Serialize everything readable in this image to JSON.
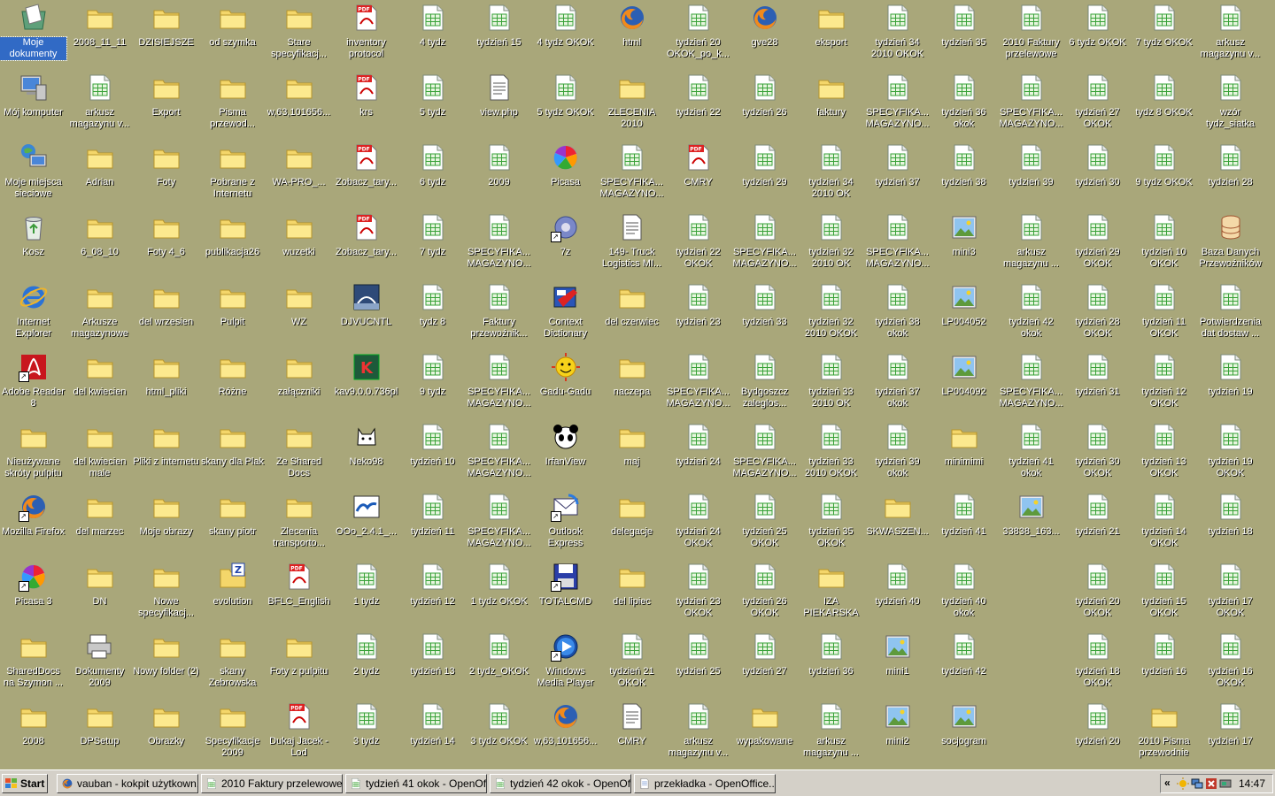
{
  "colors": {
    "desktop": "#A9A77A",
    "taskbar": "#D4D0C8",
    "selection": "#316AC5"
  },
  "columns": [
    [
      {
        "label": "Moje dokumenty",
        "icon": "my-documents-icon",
        "selected": true
      },
      {
        "label": "Mój komputer",
        "icon": "my-computer-icon"
      },
      {
        "label": "Moje miejsca sieciowe",
        "icon": "network-places-icon"
      },
      {
        "label": "Kosz",
        "icon": "recycle-bin-icon"
      },
      {
        "label": "Internet Explorer",
        "icon": "internet-explorer-icon"
      },
      {
        "label": "Adobe Reader 8",
        "icon": "adobe-reader-icon",
        "shortcut": true
      },
      {
        "label": "Nieużywane skróty pulpitu",
        "icon": "folder-icon"
      },
      {
        "label": "Mozilla Firefox",
        "icon": "firefox-icon",
        "shortcut": true
      },
      {
        "label": "Picasa 3",
        "icon": "picasa-icon",
        "shortcut": true
      },
      {
        "label": "SharedDocs na Szymon ...",
        "icon": "folder-icon"
      },
      {
        "label": "2008",
        "icon": "folder-icon"
      }
    ],
    [
      {
        "label": "2008_11_11",
        "icon": "folder-icon"
      },
      {
        "label": "arkusz magazynu v...",
        "icon": "spreadsheet-icon"
      },
      {
        "label": "Adrian",
        "icon": "folder-icon"
      },
      {
        "label": "6_08_10",
        "icon": "folder-icon"
      },
      {
        "label": "Arkusze magazynowe",
        "icon": "folder-icon"
      },
      {
        "label": "del kwiecien",
        "icon": "folder-icon"
      },
      {
        "label": "del kwiecien male",
        "icon": "folder-icon"
      },
      {
        "label": "del marzec",
        "icon": "folder-icon"
      },
      {
        "label": "DN",
        "icon": "folder-icon"
      },
      {
        "label": "Dokumenty 2009",
        "icon": "printer-folder-icon"
      },
      {
        "label": "DPSetup",
        "icon": "folder-icon"
      }
    ],
    [
      {
        "label": "DZISIEJSZE",
        "icon": "folder-icon"
      },
      {
        "label": "Export",
        "icon": "folder-icon"
      },
      {
        "label": "Foty",
        "icon": "folder-icon"
      },
      {
        "label": "Foty 4_6",
        "icon": "folder-icon"
      },
      {
        "label": "del wrzesien",
        "icon": "folder-icon"
      },
      {
        "label": "html_pliki",
        "icon": "folder-icon"
      },
      {
        "label": "Pliki z internetu",
        "icon": "folder-icon"
      },
      {
        "label": "Moje obrazy",
        "icon": "folder-icon"
      },
      {
        "label": "Nowe specyfikacj...",
        "icon": "folder-icon"
      },
      {
        "label": "Nowy folder (2)",
        "icon": "folder-icon"
      },
      {
        "label": "Obrazky",
        "icon": "folder-icon"
      }
    ],
    [
      {
        "label": "od szymka",
        "icon": "folder-icon"
      },
      {
        "label": "Pisma przewod...",
        "icon": "folder-icon"
      },
      {
        "label": "Pobrane z Internetu",
        "icon": "folder-icon"
      },
      {
        "label": "publikacja26",
        "icon": "folder-icon"
      },
      {
        "label": "Pulpit",
        "icon": "folder-icon"
      },
      {
        "label": "Różne",
        "icon": "folder-icon"
      },
      {
        "label": "skany dla Plak",
        "icon": "folder-icon"
      },
      {
        "label": "skany piotr",
        "icon": "folder-icon"
      },
      {
        "label": "evolution",
        "icon": "zip-folder-icon"
      },
      {
        "label": "skany Zebrowska",
        "icon": "folder-icon"
      },
      {
        "label": "Specyfikacje 2009",
        "icon": "folder-icon"
      }
    ],
    [
      {
        "label": "Stare specyfikacj...",
        "icon": "folder-icon"
      },
      {
        "label": "w,63,101656...",
        "icon": "folder-icon"
      },
      {
        "label": "WA-PRO_...",
        "icon": "folder-icon"
      },
      {
        "label": "wuzetki",
        "icon": "folder-icon"
      },
      {
        "label": "WZ",
        "icon": "folder-icon"
      },
      {
        "label": "załączniki",
        "icon": "folder-icon"
      },
      {
        "label": "Ze Shared Docs",
        "icon": "folder-icon"
      },
      {
        "label": "Zlecenia transporto...",
        "icon": "open-folder-icon"
      },
      {
        "label": "BFLC_English",
        "icon": "pdf-icon"
      },
      {
        "label": "Foty z pulpitu",
        "icon": "folder-icon"
      },
      {
        "label": "Dukaj Jacek - Lod",
        "icon": "pdf-icon"
      }
    ],
    [
      {
        "label": "inventory protocol",
        "icon": "pdf-icon"
      },
      {
        "label": "krs",
        "icon": "pdf-icon"
      },
      {
        "label": "Zobacz_tary...",
        "icon": "pdf-icon"
      },
      {
        "label": "Zobacz_tary...",
        "icon": "pdf-icon"
      },
      {
        "label": "DJVUCNTL",
        "icon": "djvu-icon"
      },
      {
        "label": "kav9.0.0.736pl",
        "icon": "kaspersky-icon"
      },
      {
        "label": "Neko98",
        "icon": "cat-icon"
      },
      {
        "label": "OOo_2.4.1_...",
        "icon": "openoffice-icon"
      },
      {
        "label": "1 tydz",
        "icon": "spreadsheet-icon"
      },
      {
        "label": "2 tydz",
        "icon": "spreadsheet-icon"
      },
      {
        "label": "3 tydz",
        "icon": "spreadsheet-icon"
      }
    ],
    [
      {
        "label": "4 tydz",
        "icon": "spreadsheet-icon"
      },
      {
        "label": "5 tydz",
        "icon": "spreadsheet-icon"
      },
      {
        "label": "6 tydz",
        "icon": "spreadsheet-icon"
      },
      {
        "label": "7 tydz",
        "icon": "spreadsheet-icon"
      },
      {
        "label": "tydz 8",
        "icon": "spreadsheet-icon"
      },
      {
        "label": "9 tydz",
        "icon": "spreadsheet-icon"
      },
      {
        "label": "tydzień 10",
        "icon": "spreadsheet-icon"
      },
      {
        "label": "tydzień 11",
        "icon": "spreadsheet-icon"
      },
      {
        "label": "tydzień 12",
        "icon": "spreadsheet-icon"
      },
      {
        "label": "tydzień 13",
        "icon": "spreadsheet-icon"
      },
      {
        "label": "tydzień 14",
        "icon": "spreadsheet-icon"
      }
    ],
    [
      {
        "label": "tydzień 15",
        "icon": "spreadsheet-icon"
      },
      {
        "label": "view.php",
        "icon": "php-file-icon"
      },
      {
        "label": "2009",
        "icon": "spreadsheet-icon"
      },
      {
        "label": "SPECYFIKA... MAGAZYNO...",
        "icon": "spreadsheet-icon"
      },
      {
        "label": "Faktury przewoźnik...",
        "icon": "spreadsheet-icon"
      },
      {
        "label": "SPECYFIKA... MAGAZYNO...",
        "icon": "spreadsheet-icon"
      },
      {
        "label": "SPECYFIKA... MAGAZYNO...",
        "icon": "spreadsheet-icon"
      },
      {
        "label": "SPECYFIKA... MAGAZYNO...",
        "icon": "spreadsheet-icon"
      },
      {
        "label": "1 tydz OKOK",
        "icon": "spreadsheet-icon"
      },
      {
        "label": "2 tydz_OKOK",
        "icon": "spreadsheet-icon"
      },
      {
        "label": "3 tydz OKOK",
        "icon": "spreadsheet-icon"
      }
    ],
    [
      {
        "label": "4 tydz OKOK",
        "icon": "spreadsheet-icon"
      },
      {
        "label": "5 tydz OKOK",
        "icon": "spreadsheet-icon"
      },
      {
        "label": "Picasa",
        "icon": "picasa-file-icon"
      },
      {
        "label": "7z",
        "icon": "7z-icon",
        "shortcut": true
      },
      {
        "label": "Context Dictionary",
        "icon": "dictionary-icon"
      },
      {
        "label": "Gadu-Gadu",
        "icon": "gadu-gadu-icon"
      },
      {
        "label": "IrfanView",
        "icon": "irfanview-icon"
      },
      {
        "label": "Outlook Express",
        "icon": "outlook-express-icon",
        "shortcut": true
      },
      {
        "label": "TOTALCMD",
        "icon": "totalcmd-icon",
        "shortcut": true
      },
      {
        "label": "Windows Media Player",
        "icon": "media-player-icon",
        "shortcut": true
      },
      {
        "label": "w,63,101656...",
        "icon": "firefox-html-icon"
      }
    ],
    [
      {
        "label": "html",
        "icon": "firefox-html-icon"
      },
      {
        "label": "ZLECENIA 2010",
        "icon": "folder-icon"
      },
      {
        "label": "SPECYFIKA... MAGAZYNO...",
        "icon": "spreadsheet-icon"
      },
      {
        "label": "149- Truck Logistics MI...",
        "icon": "text-file-icon"
      },
      {
        "label": "del czerwiec",
        "icon": "folder-icon"
      },
      {
        "label": "naczepa",
        "icon": "folder-icon"
      },
      {
        "label": "maj",
        "icon": "folder-icon"
      },
      {
        "label": "delegacje",
        "icon": "folder-icon"
      },
      {
        "label": "del lipiec",
        "icon": "folder-icon"
      },
      {
        "label": "tydzień 21 OKOK",
        "icon": "spreadsheet-icon"
      },
      {
        "label": "CMRY",
        "icon": "text-file-icon"
      }
    ],
    [
      {
        "label": "tydzień 20 OKOK_po_k...",
        "icon": "spreadsheet-icon"
      },
      {
        "label": "tydzień 22",
        "icon": "spreadsheet-icon"
      },
      {
        "label": "CMRY",
        "icon": "pdf-icon"
      },
      {
        "label": "tydzień 22 OKOK",
        "icon": "spreadsheet-icon"
      },
      {
        "label": "tydzień 23",
        "icon": "spreadsheet-icon"
      },
      {
        "label": "SPECYFIKA... MAGAZYNO...",
        "icon": "spreadsheet-icon"
      },
      {
        "label": "tydzień 24",
        "icon": "spreadsheet-icon"
      },
      {
        "label": "tydzień 24 OKOK",
        "icon": "spreadsheet-icon"
      },
      {
        "label": "tydzień 23 OKOK",
        "icon": "spreadsheet-icon"
      },
      {
        "label": "tydzień 25",
        "icon": "spreadsheet-icon"
      },
      {
        "label": "arkusz magazynu v...",
        "icon": "spreadsheet-icon"
      }
    ],
    [
      {
        "label": "gve28",
        "icon": "firefox-html-icon"
      },
      {
        "label": "tydzień 26",
        "icon": "spreadsheet-icon"
      },
      {
        "label": "tydzień 29",
        "icon": "spreadsheet-icon"
      },
      {
        "label": "SPECYFIKA... MAGAZYNO...",
        "icon": "spreadsheet-icon"
      },
      {
        "label": "tydzień 33",
        "icon": "spreadsheet-icon"
      },
      {
        "label": "Bydgoszcz zaleglos...",
        "icon": "spreadsheet-icon"
      },
      {
        "label": "SPECYFIKA... MAGAZYNO...",
        "icon": "spreadsheet-icon"
      },
      {
        "label": "tydzień 25 OKOK",
        "icon": "spreadsheet-icon"
      },
      {
        "label": "tydzień 26 OKOK",
        "icon": "spreadsheet-icon"
      },
      {
        "label": "tydzień 27",
        "icon": "spreadsheet-icon"
      },
      {
        "label": "wypakowane",
        "icon": "folder-icon"
      }
    ],
    [
      {
        "label": "eksport",
        "icon": "folder-icon"
      },
      {
        "label": "faktury",
        "icon": "folder-icon"
      },
      {
        "label": "tydzień 34 2010 OK",
        "icon": "spreadsheet-icon"
      },
      {
        "label": "tydzień 32 2010 OK",
        "icon": "spreadsheet-icon"
      },
      {
        "label": "tydzień 32 2010 OKOK",
        "icon": "spreadsheet-icon"
      },
      {
        "label": "tydzień 33 2010 OK",
        "icon": "spreadsheet-icon"
      },
      {
        "label": "tydzień 33 2010 OKOK",
        "icon": "spreadsheet-icon"
      },
      {
        "label": "tydzień 35 OKOK",
        "icon": "spreadsheet-icon"
      },
      {
        "label": "IZA PIEKARSKA",
        "icon": "folder-icon"
      },
      {
        "label": "tydzień 36",
        "icon": "spreadsheet-icon"
      },
      {
        "label": "arkusz magazynu ...",
        "icon": "spreadsheet-icon"
      }
    ],
    [
      {
        "label": "tydzień 34 2010 OKOK",
        "icon": "spreadsheet-icon"
      },
      {
        "label": "SPECYFIKA... MAGAZYNO...",
        "icon": "spreadsheet-icon"
      },
      {
        "label": "tydzień 37",
        "icon": "spreadsheet-icon"
      },
      {
        "label": "SPECYFIKA... MAGAZYNO...",
        "icon": "spreadsheet-icon"
      },
      {
        "label": "tydzień 38 okok",
        "icon": "spreadsheet-icon"
      },
      {
        "label": "tydzień 37 okok",
        "icon": "spreadsheet-icon"
      },
      {
        "label": "tydzień 39 okok",
        "icon": "spreadsheet-icon"
      },
      {
        "label": "SKWASZEN...",
        "icon": "folder-icon"
      },
      {
        "label": "tydzień 40",
        "icon": "spreadsheet-icon"
      },
      {
        "label": "mini1",
        "icon": "image-icon"
      },
      {
        "label": "mini2",
        "icon": "image-icon"
      }
    ],
    [
      {
        "label": "tydzień 35",
        "icon": "spreadsheet-icon"
      },
      {
        "label": "tydzień 36 okok",
        "icon": "spreadsheet-icon"
      },
      {
        "label": "tydzień 38",
        "icon": "spreadsheet-icon"
      },
      {
        "label": "mini3",
        "icon": "image-icon"
      },
      {
        "label": "LP004052",
        "icon": "image-icon"
      },
      {
        "label": "LP004092",
        "icon": "image-icon"
      },
      {
        "label": "minimimi",
        "icon": "folder-icon"
      },
      {
        "label": "tydzień 41",
        "icon": "spreadsheet-icon"
      },
      {
        "label": "tydzień 40 okok",
        "icon": "spreadsheet-icon"
      },
      {
        "label": "tydzień 42",
        "icon": "spreadsheet-icon"
      },
      {
        "label": "socjogram",
        "icon": "image-icon"
      }
    ],
    [
      {
        "label": "2010 Faktury przelewowe",
        "icon": "spreadsheet-icon"
      },
      {
        "label": "SPECYFIKA... MAGAZYNO...",
        "icon": "spreadsheet-icon"
      },
      {
        "label": "tydzień 39",
        "icon": "spreadsheet-icon"
      },
      {
        "label": "arkusz magazynu ...",
        "icon": "spreadsheet-icon"
      },
      {
        "label": "tydzień 42 okok",
        "icon": "spreadsheet-icon"
      },
      {
        "label": "SPECYFIKA... MAGAZYNO...",
        "icon": "spreadsheet-icon"
      },
      {
        "label": "tydzień 41 okok",
        "icon": "spreadsheet-icon"
      },
      {
        "label": "33838_163...",
        "icon": "image-icon"
      },
      null,
      null,
      null
    ],
    [
      {
        "label": "6 tydz OKOK",
        "icon": "spreadsheet-icon"
      },
      {
        "label": "tydzień 27 OKOK",
        "icon": "spreadsheet-icon"
      },
      {
        "label": "tydzień 30",
        "icon": "spreadsheet-icon"
      },
      {
        "label": "tydzień 29 OKOK",
        "icon": "spreadsheet-icon"
      },
      {
        "label": "tydzień 28 OKOK",
        "icon": "spreadsheet-icon"
      },
      {
        "label": "tydzień 31",
        "icon": "spreadsheet-icon"
      },
      {
        "label": "tydzień 30 OKOK",
        "icon": "spreadsheet-icon"
      },
      {
        "label": "tydzień 21",
        "icon": "spreadsheet-icon"
      },
      {
        "label": "tydzień 20 OKOK",
        "icon": "spreadsheet-icon"
      },
      {
        "label": "tydzień 18 OKOK",
        "icon": "spreadsheet-icon"
      },
      {
        "label": "tydzień 20",
        "icon": "spreadsheet-icon"
      }
    ],
    [
      {
        "label": "7 tydz OKOK",
        "icon": "spreadsheet-icon"
      },
      {
        "label": "tydz 8 OKOK",
        "icon": "spreadsheet-icon"
      },
      {
        "label": "9 tydz OKOK",
        "icon": "spreadsheet-icon"
      },
      {
        "label": "tydzień 10 OKOK",
        "icon": "spreadsheet-icon"
      },
      {
        "label": "tydzień 11 OKOK",
        "icon": "spreadsheet-icon"
      },
      {
        "label": "tydzień 12 OKOK",
        "icon": "spreadsheet-icon"
      },
      {
        "label": "tydzień 13 OKOK",
        "icon": "spreadsheet-icon"
      },
      {
        "label": "tydzień 14 OKOK",
        "icon": "spreadsheet-icon"
      },
      {
        "label": "tydzień 15 OKOK",
        "icon": "spreadsheet-icon"
      },
      {
        "label": "tydzień 16",
        "icon": "spreadsheet-icon"
      },
      {
        "label": "2010 Pisma przewodnie",
        "icon": "folder-icon"
      }
    ],
    [
      {
        "label": "arkusz magazynu v...",
        "icon": "spreadsheet-icon"
      },
      {
        "label": "wzór tydz_siatka",
        "icon": "spreadsheet-icon"
      },
      {
        "label": "tydzień 28",
        "icon": "spreadsheet-icon"
      },
      {
        "label": "Baza Danych Przewoźników",
        "icon": "database-icon"
      },
      {
        "label": "Potwierdzenia dat dostaw ...",
        "icon": "spreadsheet-icon"
      },
      {
        "label": "tydzień 19",
        "icon": "spreadsheet-icon"
      },
      {
        "label": "tydzień 19 OKOK",
        "icon": "spreadsheet-icon"
      },
      {
        "label": "tydzień 18",
        "icon": "spreadsheet-icon"
      },
      {
        "label": "tydzień 17 OKOK",
        "icon": "spreadsheet-icon"
      },
      {
        "label": "tydzień 16 OKOK",
        "icon": "spreadsheet-icon"
      },
      {
        "label": "tydzień 17",
        "icon": "spreadsheet-icon"
      }
    ]
  ],
  "taskbar": {
    "start_label": "Start",
    "tasks": [
      {
        "label": "vauban - kokpit użytkown...",
        "icon": "firefox-icon"
      },
      {
        "label": "2010 Faktury przelewowe...",
        "icon": "spreadsheet-icon"
      },
      {
        "label": "tydzień 41 okok - OpenOf...",
        "icon": "spreadsheet-icon"
      },
      {
        "label": "tydzień 42 okok - OpenOf...",
        "icon": "spreadsheet-icon"
      },
      {
        "label": "przekładka - OpenOffice....",
        "icon": "text-document-icon"
      }
    ],
    "tray_arrows": "«",
    "clock": "14:47"
  }
}
